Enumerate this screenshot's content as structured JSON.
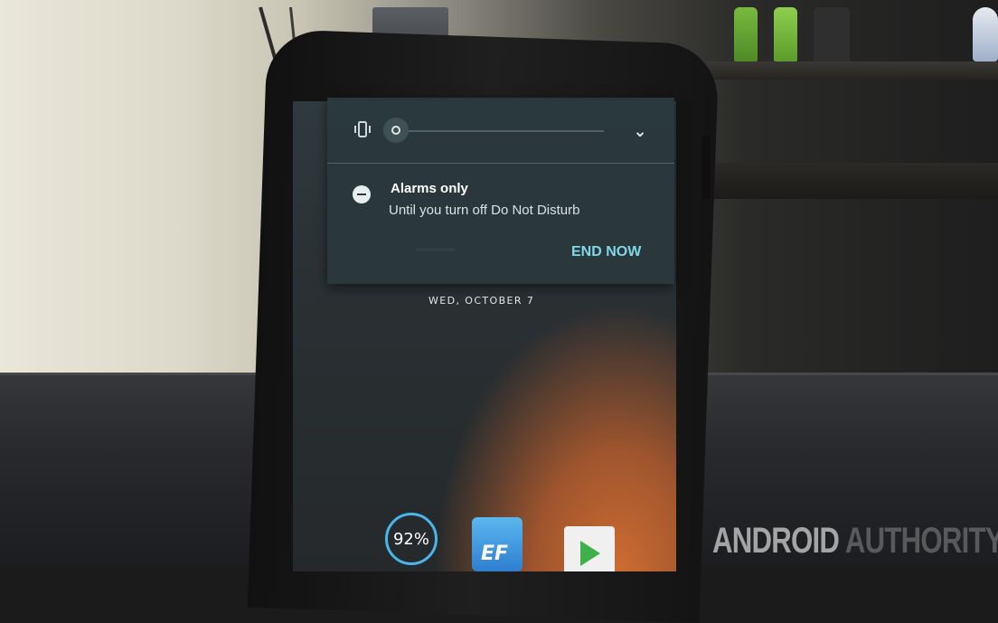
{
  "volume_panel": {
    "vibrate_icon": "vibrate-icon",
    "expand_icon": "chevron-down-icon",
    "expand_glyph": "⌄"
  },
  "dnd_notification": {
    "icon": "do-not-disturb-icon",
    "title": "Alarms only",
    "subtitle": "Until you turn off Do Not Disturb",
    "action_label": "END NOW"
  },
  "lockscreen": {
    "date": "WED, OCTOBER 7"
  },
  "dock": {
    "battery_percent": "92%",
    "ef_label": "EF"
  },
  "watermark": {
    "part1": "ANDROID",
    "part2": " AUTHORITY"
  },
  "colors": {
    "accent": "#7fd7e8",
    "shade_bg": "#2a393d",
    "battery_ring": "#4ab5e8"
  }
}
